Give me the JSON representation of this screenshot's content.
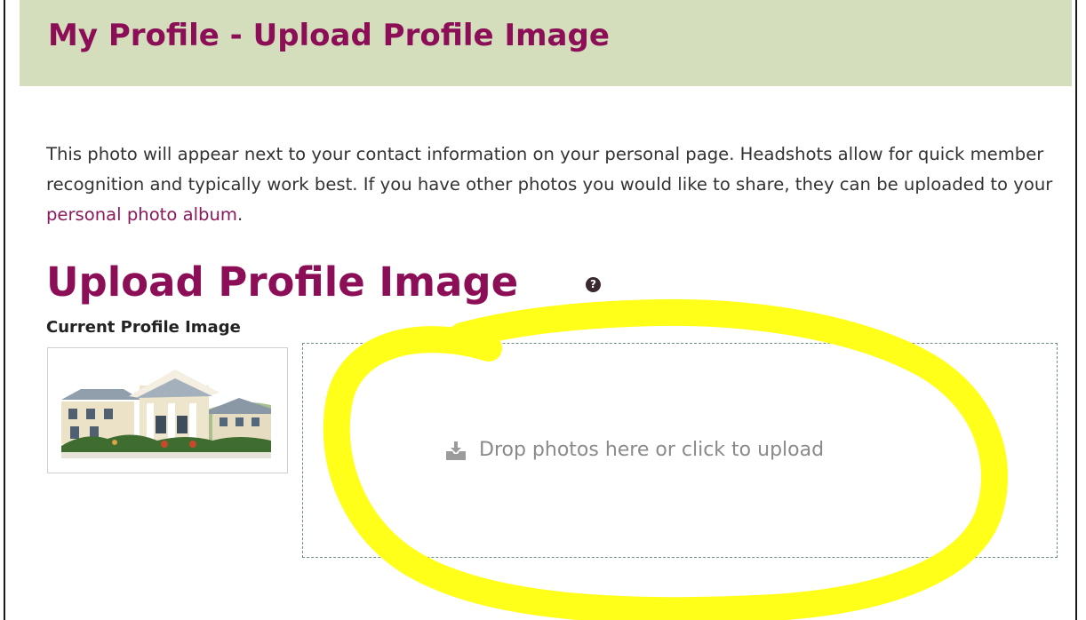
{
  "header": {
    "title": "My Profile - Upload Profile Image"
  },
  "intro": {
    "text_before_link": "This photo will appear next to your contact information on your personal page. Headshots allow for quick member recognition and typically work best. If you have other photos you would like to share, they can be uploaded to your ",
    "link_label": "personal photo album",
    "text_after_link": "."
  },
  "upload_section": {
    "title": "Upload Profile Image",
    "help_icon": "question-circle-icon",
    "help_glyph": "?",
    "current_image_label": "Current Profile Image",
    "dropzone_icon": "upload-tray-icon",
    "dropzone_label": "Drop photos here or click to upload"
  },
  "colors": {
    "header_background": "#d4ddbc",
    "title_color": "#8b0e57",
    "link_color": "#8b1a5c",
    "highlight_marker": "#ffff1a"
  }
}
